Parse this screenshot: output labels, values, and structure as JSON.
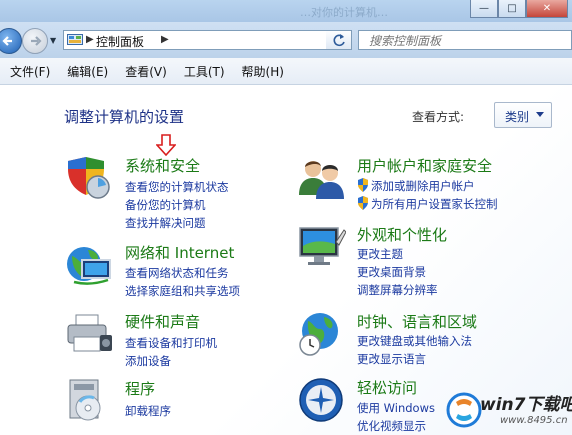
{
  "window": {
    "ghost_title": "…对你的计算机…",
    "min_glyph": "—",
    "max_glyph": "□",
    "close_glyph": "✕"
  },
  "address": {
    "crumb": "控制面板",
    "sep_glyph": "▶",
    "search_placeholder": "搜索控制面板"
  },
  "menu": [
    "文件(F)",
    "编辑(E)",
    "查看(V)",
    "工具(T)",
    "帮助(H)"
  ],
  "page": {
    "title": "调整计算机的设置",
    "view_by_label": "查看方式:",
    "view_by_value": "类别"
  },
  "categories": [
    {
      "title": "系统和安全",
      "icon": "shield-icon",
      "links": [
        "查看您的计算机状态",
        "备份您的计算机",
        "查找并解决问题"
      ]
    },
    {
      "title": "网络和 Internet",
      "icon": "globe-network-icon",
      "links": [
        "查看网络状态和任务",
        "选择家庭组和共享选项"
      ]
    },
    {
      "title": "硬件和声音",
      "icon": "printer-icon",
      "links": [
        "查看设备和打印机",
        "添加设备"
      ]
    },
    {
      "title": "程序",
      "icon": "programs-icon",
      "links": [
        "卸载程序"
      ]
    },
    {
      "title": "用户帐户和家庭安全",
      "icon": "users-icon",
      "links": [
        "添加或删除用户帐户",
        "为所有用户设置家长控制"
      ]
    },
    {
      "title": "外观和个性化",
      "icon": "monitor-icon",
      "links": [
        "更改主题",
        "更改桌面背景",
        "调整屏幕分辨率"
      ]
    },
    {
      "title": "时钟、语言和区域",
      "icon": "clock-globe-icon",
      "links": [
        "更改键盘或其他输入法",
        "更改显示语言"
      ]
    },
    {
      "title": "轻松访问",
      "icon": "ease-of-access-icon",
      "links": [
        "使用 Windows",
        "优化视频显示"
      ]
    }
  ],
  "watermark": {
    "text": "win7下载吧",
    "url": "www.8495.cn"
  }
}
